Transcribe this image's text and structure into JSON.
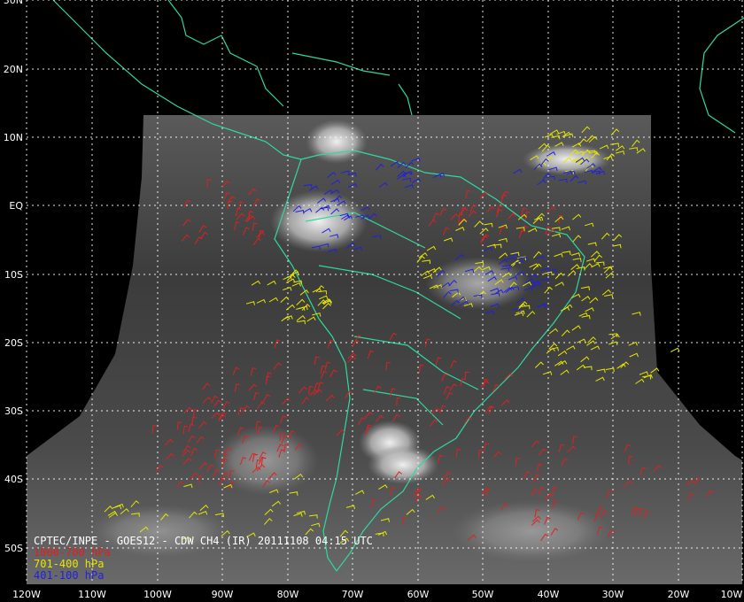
{
  "map": {
    "source_line": "CPTEC/INPE - GOES12 - CDW CH4 (IR) 20111108 04:15 UTC",
    "legend": [
      {
        "label": "1000-700 hPa",
        "color": "#e02020"
      },
      {
        "label": "701-400 hPa",
        "color": "#e6e600"
      },
      {
        "label": "401-100 hPa",
        "color": "#2020e0"
      }
    ],
    "lat_labels": [
      "30N",
      "20N",
      "10N",
      "EQ",
      "10S",
      "20S",
      "30S",
      "40S",
      "50S"
    ],
    "lon_labels": [
      "120W",
      "110W",
      "100W",
      "90W",
      "80W",
      "70W",
      "60W",
      "50W",
      "40W",
      "30W",
      "20W",
      "10W"
    ],
    "colors": {
      "background": "#000000",
      "coastline": "#30d8a0",
      "grid": "#ffffff",
      "label_text": "#ffffff"
    }
  }
}
